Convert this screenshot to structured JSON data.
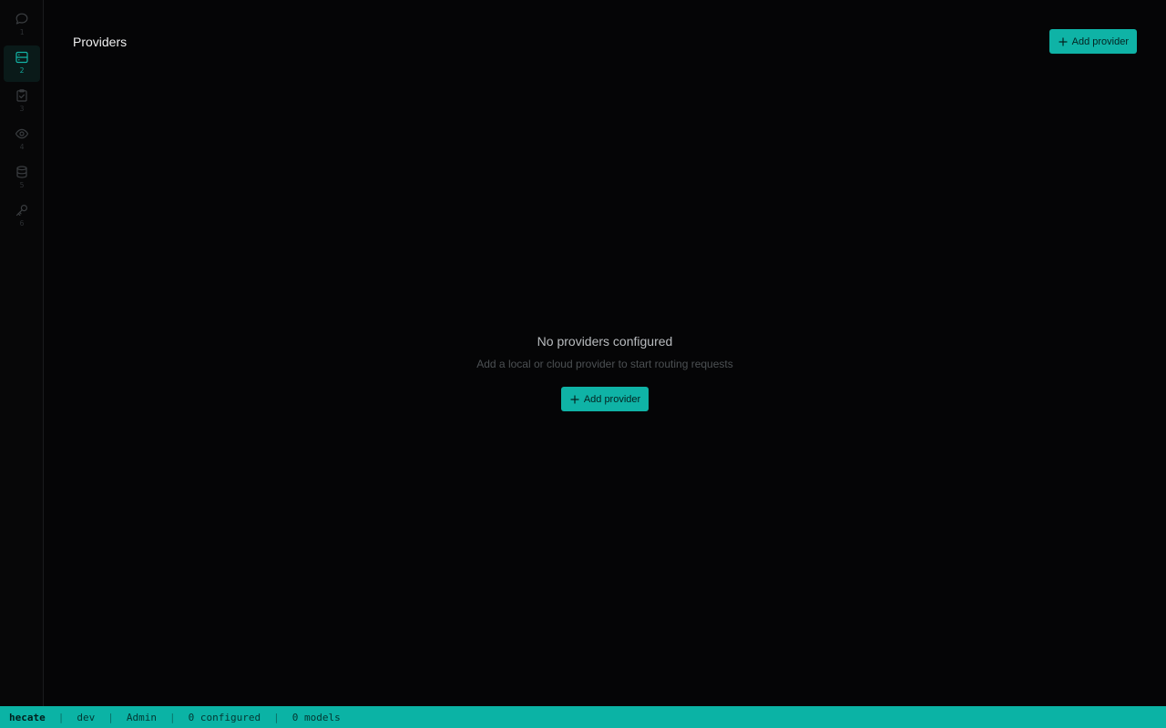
{
  "sidebar": {
    "items": [
      {
        "icon": "chat-bubble-icon",
        "num": "1",
        "active": false
      },
      {
        "icon": "server-icon",
        "num": "2",
        "active": true
      },
      {
        "icon": "clipboard-check-icon",
        "num": "3",
        "active": false
      },
      {
        "icon": "eye-icon",
        "num": "4",
        "active": false
      },
      {
        "icon": "database-icon",
        "num": "5",
        "active": false
      },
      {
        "icon": "key-icon",
        "num": "6",
        "active": false
      }
    ]
  },
  "header": {
    "title": "Providers",
    "add_button_label": "Add provider"
  },
  "empty_state": {
    "title": "No providers configured",
    "subtitle": "Add a local or cloud provider to start routing requests",
    "button_label": "Add provider"
  },
  "statusbar": {
    "app_name": "hecate",
    "env": "dev",
    "user": "Admin",
    "configured": "0 configured",
    "models": "0 models"
  },
  "colors": {
    "accent": "#0fb3a6",
    "background": "#050506",
    "statusbar": "#0bb3a5"
  }
}
